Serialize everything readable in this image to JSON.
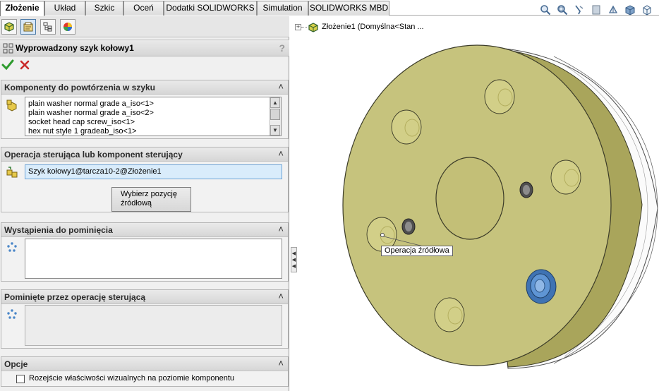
{
  "tabs": [
    {
      "label": "Złożenie",
      "active": true
    },
    {
      "label": "Układ",
      "active": false
    },
    {
      "label": "Szkic",
      "active": false
    },
    {
      "label": "Oceń",
      "active": false
    },
    {
      "label": "Dodatki SOLIDWORKS",
      "active": false
    },
    {
      "label": "Simulation",
      "active": false
    },
    {
      "label": "SOLIDWORKS MBD",
      "active": false
    }
  ],
  "view_toolbar": {
    "icons": [
      "zoom-to-fit-icon",
      "zoom-to-area-icon",
      "previous-view-icon",
      "section-view-icon",
      "view-orientation-icon",
      "display-style-icon",
      "hide-show-items-icon"
    ]
  },
  "property_manager": {
    "tab_icons": [
      "feature-manager-icon",
      "property-manager-icon",
      "configuration-manager-icon",
      "appearance-manager-icon"
    ],
    "feature_title": "Wyprowadzony szyk kołowy1",
    "help_label": "?",
    "groups": {
      "components": {
        "title": "Komponenty do powtórzenia w szyku",
        "items": [
          "plain washer normal grade a_iso<1>",
          "plain washer normal grade a_iso<2>",
          "socket head cap screw_iso<1>",
          "hex nut style 1 gradeab_iso<1>"
        ]
      },
      "driving": {
        "title": "Operacja sterująca lub komponent sterujący",
        "value": "Szyk kołowy1@tarcza10-2@Złożenie1",
        "button_line1": "Wybierz pozycję",
        "button_line2": "źródłową"
      },
      "skip": {
        "title": "Wystąpienia do pominięcia"
      },
      "skipped_by_driving": {
        "title": "Pominięte przez operację sterującą"
      },
      "options": {
        "title": "Opcje",
        "checkbox_label": "Rozejście właściwości wizualnych na poziomie komponentu",
        "checkbox_checked": false
      }
    }
  },
  "graphics": {
    "tree_label": "Złożenie1  (Domyślna<Stan ...",
    "callout": "Operacja źródłowa",
    "colors": {
      "part_face": "#c6c37d",
      "part_side": "#a8a45a",
      "part_edge": "#3b3b28",
      "nut": "#4d86c8",
      "accent": "#2e7d32",
      "cancel": "#c62828"
    }
  }
}
